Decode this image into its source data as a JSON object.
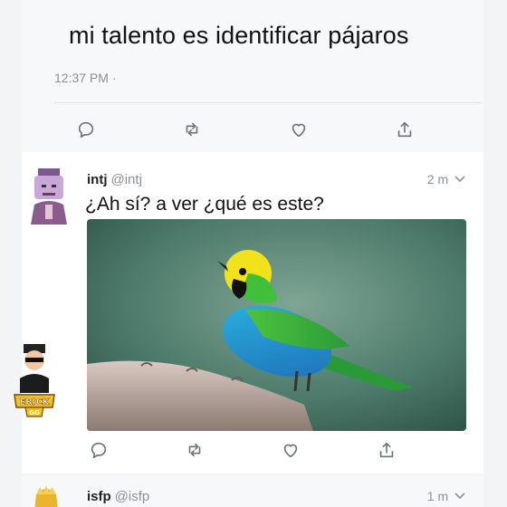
{
  "main_tweet": {
    "text": "mi talento es identificar pájaros",
    "time": "12:37 PM ·"
  },
  "reply_tweet": {
    "display_name": "intj",
    "handle": "@intj",
    "time": "2 m",
    "text": "¿Ah sí? a ver ¿qué es este?"
  },
  "next_tweet": {
    "display_name": "isfp",
    "handle": "@isfp",
    "time": "1 m"
  },
  "watermark": {
    "text": "ERICK GG"
  },
  "icons": {
    "reply": "reply-icon",
    "retweet": "retweet-icon",
    "like": "heart-icon",
    "share": "share-icon",
    "chevron": "chevron-down-icon"
  },
  "colors": {
    "icon_gray": "#6b747d",
    "meta_gray": "#8a9199",
    "divider": "#dfe3e7"
  }
}
